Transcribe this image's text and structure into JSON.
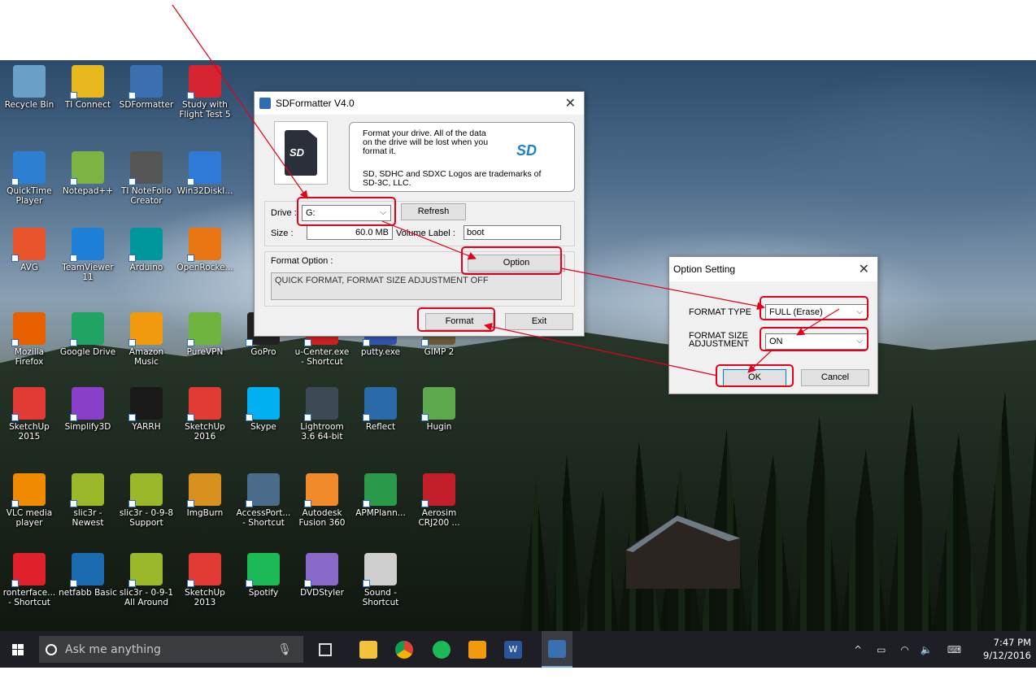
{
  "desktop_icons": [
    {
      "name": "recycle-bin-icon",
      "label": "Recycle Bin",
      "color": "#6aa0c8"
    },
    {
      "name": "ti-connect-icon",
      "label": "TI Connect",
      "color": "#e8b81d"
    },
    {
      "name": "sdformatter-icon",
      "label": "SDFormatter",
      "color": "#3a6fb0"
    },
    {
      "name": "study-with-flight-test-icon",
      "label": "Study with\nFlight Test 5",
      "color": "#d5232f"
    },
    {
      "name": "quicktime-icon",
      "label": "QuickTime\nPlayer",
      "color": "#2d7fd1"
    },
    {
      "name": "notepadpp-icon",
      "label": "Notepad++",
      "color": "#7cb342"
    },
    {
      "name": "ti-notefolio-icon",
      "label": "TI NoteFolio\nCreator",
      "color": "#555555"
    },
    {
      "name": "win32diskimager-icon",
      "label": "Win32DiskI...",
      "color": "#2f7ad6"
    },
    {
      "name": "avg-icon",
      "label": "AVG",
      "color": "#e9542b"
    },
    {
      "name": "teamviewer-icon",
      "label": "TeamViewer\n11",
      "color": "#1e7fd6"
    },
    {
      "name": "arduino-icon",
      "label": "Arduino",
      "color": "#00979c"
    },
    {
      "name": "openrocket-icon",
      "label": "OpenRocke...",
      "color": "#e87511"
    },
    {
      "name": "firefox-icon",
      "label": "Mozilla\nFirefox",
      "color": "#e66000"
    },
    {
      "name": "google-drive-icon",
      "label": "Google Drive",
      "color": "#1fa463"
    },
    {
      "name": "amazon-music-icon",
      "label": "Amazon\nMusic",
      "color": "#f29a0e"
    },
    {
      "name": "purevpn-icon",
      "label": "PureVPN",
      "color": "#6fb43f"
    },
    {
      "name": "gopro-icon",
      "label": "GoPro",
      "color": "#222222"
    },
    {
      "name": "u-center-icon",
      "label": "u-Center.exe\n- Shortcut",
      "color": "#cc2222"
    },
    {
      "name": "putty-icon",
      "label": "putty.exe",
      "color": "#3355aa"
    },
    {
      "name": "gimp-icon",
      "label": "GIMP 2",
      "color": "#6b5a3a"
    },
    {
      "name": "sketchup-2015-icon",
      "label": "SketchUp\n2015",
      "color": "#e23b35"
    },
    {
      "name": "simplify3d-icon",
      "label": "Simplify3D",
      "color": "#8a3fc9"
    },
    {
      "name": "yarrh-icon",
      "label": "YARRH",
      "color": "#1a1a1a"
    },
    {
      "name": "sketchup-2016-icon",
      "label": "SketchUp\n2016",
      "color": "#e23b35"
    },
    {
      "name": "skype-icon",
      "label": "Skype",
      "color": "#00aff0"
    },
    {
      "name": "lightroom-icon",
      "label": "Lightroom\n3.6 64-bit",
      "color": "#3d4a55"
    },
    {
      "name": "reflect-icon",
      "label": "Reflect",
      "color": "#2b6aa8"
    },
    {
      "name": "hugin-icon",
      "label": "Hugin",
      "color": "#5ea84e"
    },
    {
      "name": "vlc-icon",
      "label": "VLC media\nplayer",
      "color": "#f08a00"
    },
    {
      "name": "slic3r-newest-icon",
      "label": "slic3r -\nNewest",
      "color": "#9ab82a"
    },
    {
      "name": "slic3r-support-icon",
      "label": "slic3r - 0-9-8\nSupport",
      "color": "#9ab82a"
    },
    {
      "name": "imgburn-icon",
      "label": "ImgBurn",
      "color": "#d9901e"
    },
    {
      "name": "accessport-icon",
      "label": "AccessPort...\n- Shortcut",
      "color": "#4a6b8a"
    },
    {
      "name": "autodesk-fusion-icon",
      "label": "Autodesk\nFusion 360",
      "color": "#f08a2a"
    },
    {
      "name": "apmplanner-icon",
      "label": "APMPlann...",
      "color": "#2a9a4a"
    },
    {
      "name": "aerosim-icon",
      "label": "Aerosim\nCRJ200 ...",
      "color": "#c21f2a"
    },
    {
      "name": "processing-interface-icon",
      "label": "ronterface...\n- Shortcut",
      "color": "#e0202a"
    },
    {
      "name": "netfabb-icon",
      "label": "netfabb Basic",
      "color": "#1a6ab0"
    },
    {
      "name": "slic3r-all-around-icon",
      "label": "slic3r - 0-9-1\nAll Around",
      "color": "#9ab82a"
    },
    {
      "name": "sketchup-2013-icon",
      "label": "SketchUp\n2013",
      "color": "#e23b35"
    },
    {
      "name": "spotify-icon",
      "label": "Spotify",
      "color": "#1db954"
    },
    {
      "name": "dvdstyler-icon",
      "label": "DVDStyler",
      "color": "#8a6ac8"
    },
    {
      "name": "sound-shortcut-icon",
      "label": "Sound -\nShortcut",
      "color": "#cfcfcf"
    }
  ],
  "taskbar": {
    "search_placeholder": "Ask me anything",
    "time": "7:47 PM",
    "date": "9/12/2016",
    "pinned": [
      "task-view",
      "file-explorer",
      "chrome",
      "spotify",
      "amazon",
      "word",
      "sdformatter"
    ]
  },
  "sdformatter": {
    "title": "SDFormatter V4.0",
    "info_line1": "Format your drive. All of the data",
    "info_line2": "on the drive will be lost when you",
    "info_line3": "format it.",
    "trademark_line1": "SD, SDHC and SDXC Logos are trademarks of",
    "trademark_line2": "SD-3C, LLC.",
    "drive_label": "Drive :",
    "drive_value": "G:",
    "refresh_label": "Refresh",
    "size_label": "Size :",
    "size_value": "60.0 MB",
    "volume_label": "Volume Label :",
    "volume_value": "boot",
    "format_option_label": "Format Option :",
    "option_button": "Option",
    "format_option_value": "QUICK FORMAT, FORMAT SIZE ADJUSTMENT OFF",
    "format_button": "Format",
    "exit_button": "Exit"
  },
  "option_setting": {
    "title": "Option Setting",
    "format_type_label": "FORMAT TYPE",
    "format_type_value": "FULL (Erase)",
    "format_size_label_1": "FORMAT SIZE",
    "format_size_label_2": "ADJUSTMENT",
    "format_size_value": "ON",
    "ok_button": "OK",
    "cancel_button": "Cancel"
  },
  "annotation_color": "#e2001a"
}
